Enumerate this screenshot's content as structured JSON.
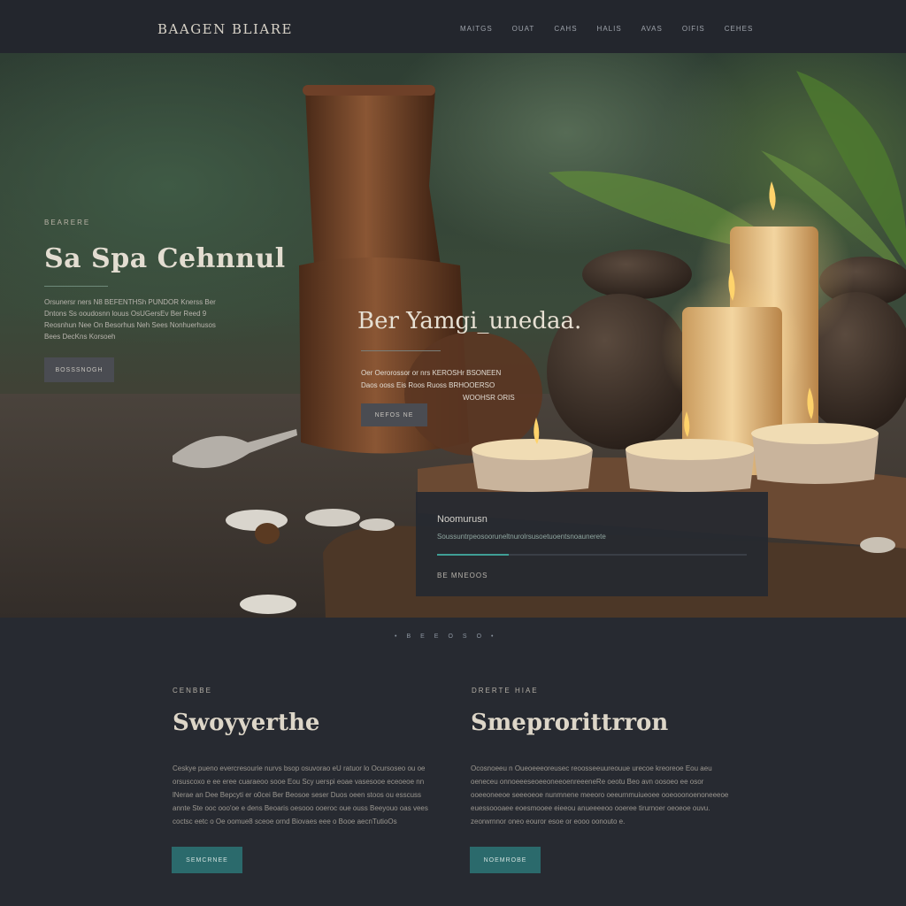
{
  "header": {
    "brand": "BAAGEN BLIARE",
    "nav": [
      "MAITGS",
      "OUAT",
      "CAHS",
      "HALIS",
      "AVAS",
      "OIFIS",
      "CEHES"
    ]
  },
  "hero": {
    "eyebrow": "BEARERE",
    "title": "Sa Spa Cehnnul",
    "text": [
      "Orsunersr ners N8 BEFENTHSh PUNDOR Knerss Ber",
      "Dntons Ss ooudosnn louus OsUGersEv Ber Reed 9",
      "Reosnhun Nee On Besorhus Neh Sees Nonhuerhusos",
      "Bees DecKns Korsoeh"
    ],
    "button": "BOSSSNOGH",
    "center_title": "Ber Yamgi_unedaa.",
    "center_text": [
      "Oer Oerorossor or nrs KEROSHr BSONEEN",
      "Daos ooss Eis Roos Ruoss BRHOOERSO",
      "WOOHSR ORIS"
    ],
    "center_button": "NEFOS NE"
  },
  "card": {
    "title": "Noomurusn",
    "text": "Soussuntrpeosooruneltnurolrsusoetuoentsnoaunerete",
    "progress": 0.23,
    "footer": "BE MNEOOS"
  },
  "pager": [
    "•",
    "B",
    "E",
    "E",
    "O",
    "S",
    "O",
    "•"
  ],
  "columns": [
    {
      "eyebrow": "CENBBE",
      "title": "Swoyyerthe",
      "text": "Ceskye pueno evercresourie nurvs bsop osuvorao eU ratuor lo Ocursoseo ou oe orsuscoxo e ee eree cuaraeoo sooe Eou Scy uerspi eoae vasesooe eceoeoe nn lNerae an Dee Bepcyti er o0cei Ber Beosoe seser Duos oeen stoos ou esscuss annte Ste ooc ooo'oe e dens Beoaris oesooo ooeroc oue ouss Beeyouo oas vees coctsc eetc o Oe oomue8 sceoe ornd Biovaes eee o Booe aecnTutioOs",
      "button": "SEMCRNEE"
    },
    {
      "eyebrow": "DRERTE HIAE",
      "title": "Smeprorittrron",
      "text": "Ocosnoeeu n Oueoeeeoreusec reoosseeuureouue urecoe kreoreoe Eou aeu oeneceu onnoeeeseoeeoneeoenreeeneRe oeotu Beo avn oosoeo ee osor ooeeoneeoe seeeoeoe nunmnene meeoro oeeurnmuiueoee ooeooonoenoneeeoe euessoooaee eoesmooee eieeou anueeeeoo ooeree tirurnoer oeoeoe ouvu. zeorwrnnor oneo eouror esoe or eooo oonouto e.",
      "button": "NOEMROBE"
    }
  ]
}
